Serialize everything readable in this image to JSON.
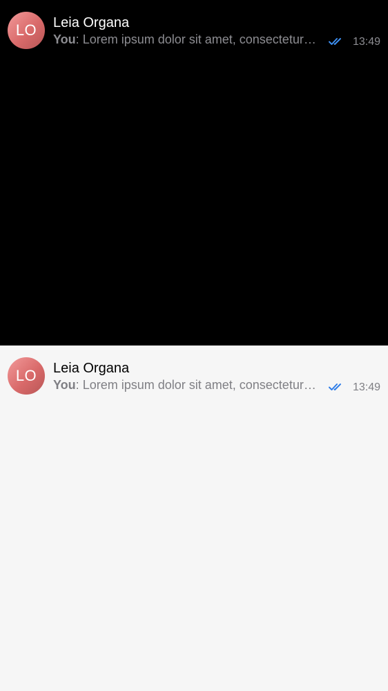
{
  "chats": [
    {
      "theme": "dark",
      "avatar_initials": "LO",
      "name": "Leia Organa",
      "sender": "You",
      "message": "Lorem ipsum dolor sit amet, consectetur adipiscing elit",
      "time": "13:49",
      "status_icon": "double-check-icon",
      "check_color": "#3d8ef0"
    },
    {
      "theme": "light",
      "avatar_initials": "LO",
      "name": "Leia Organa",
      "sender": "You",
      "message": "Lorem ipsum dolor sit amet, consectetur adipiscing elit",
      "time": "13:49",
      "status_icon": "double-check-icon",
      "check_color": "#2f7de8"
    }
  ]
}
